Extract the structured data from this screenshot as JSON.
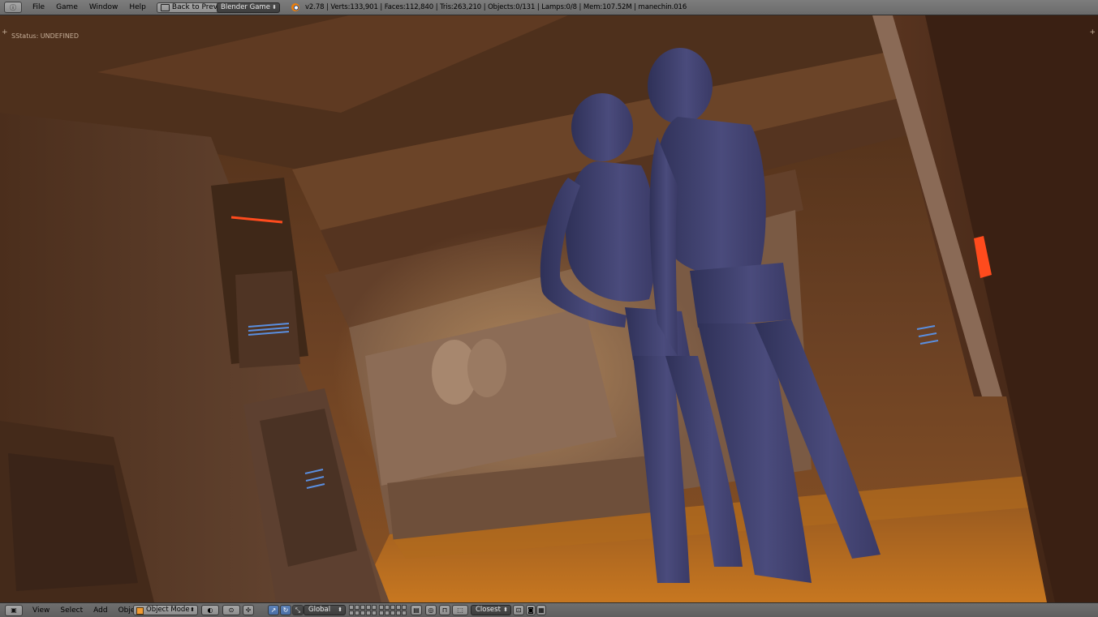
{
  "topbar": {
    "editor_icon": "info-icon",
    "menus": [
      "File",
      "Game",
      "Window",
      "Help"
    ],
    "back_button": "Back to Previous",
    "render_engine": "Blender Game",
    "stats": "v2.78 | Verts:133,901 | Faces:112,840 | Tris:263,210 | Objects:0/131 | Lamps:0/8 | Mem:107.52M | manechin.016"
  },
  "viewport": {
    "status": "SStatus: UNDEFINED",
    "corner_left": "+",
    "corner_right": "+"
  },
  "bottombar": {
    "editor_icon": "3d-view-icon",
    "menus": [
      "View",
      "Select",
      "Add",
      "Object"
    ],
    "mode": "Object Mode",
    "pivot": "Global",
    "snap_target": "Closest"
  }
}
